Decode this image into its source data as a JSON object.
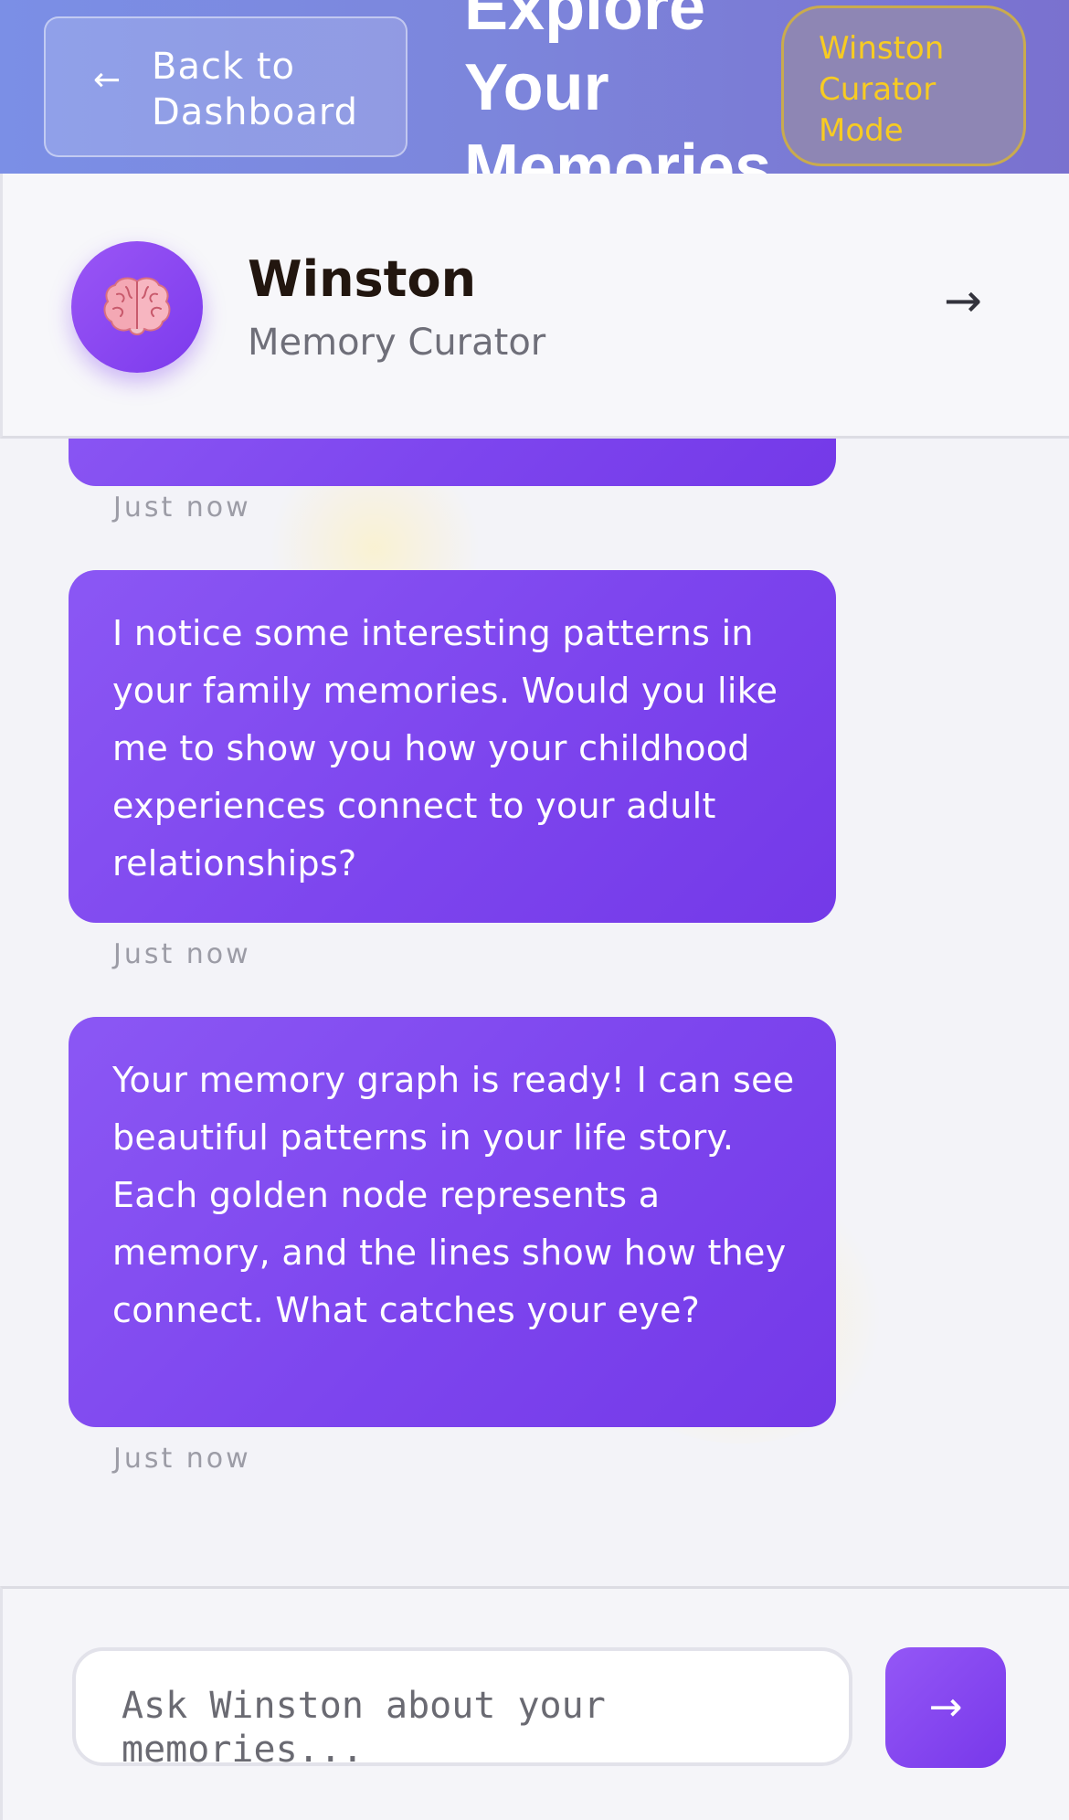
{
  "header": {
    "back_arrow": "←",
    "back_label": "Back to Dashboard",
    "title": "Explore Your Memories",
    "mode_badge": "Winston Curator Mode"
  },
  "curator": {
    "avatar_icon": "brain-icon",
    "name": "Winston",
    "role": "Memory Curator",
    "next_icon": "→"
  },
  "messages": [
    {
      "text": "",
      "timestamp": "Just now"
    },
    {
      "text": "I notice some interesting patterns in your family memories. Would you like me to show you how your childhood experiences connect to your adult relationships?",
      "timestamp": "Just now"
    },
    {
      "text": "Your memory graph is ready! I can see beautiful patterns in your life story. Each golden node represents a memory, and the lines show how they connect. What catches your eye?",
      "timestamp": "Just now"
    }
  ],
  "input": {
    "placeholder": "Ask Winston about your memories...",
    "send_icon": "→"
  },
  "colors": {
    "header_start": "#7b8fe6",
    "header_end": "#7a71cf",
    "bubble": "#7c3aed",
    "badge_text": "#f7cb22",
    "name_text": "#22160f"
  }
}
